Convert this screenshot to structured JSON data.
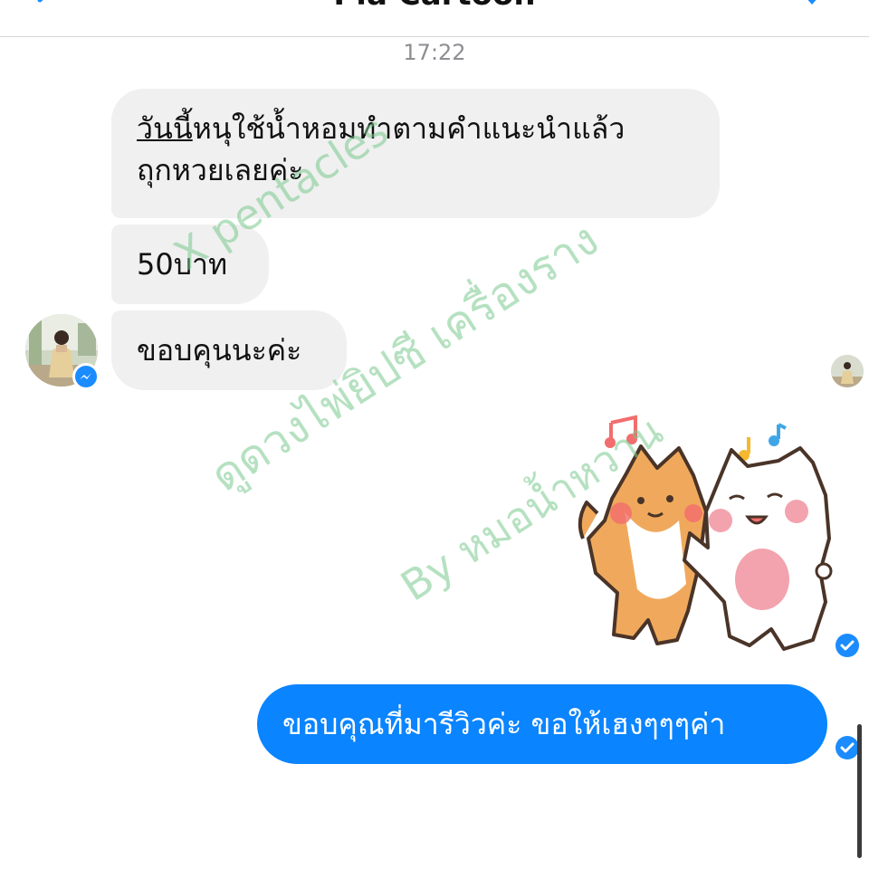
{
  "header": {
    "title": "Pla Cartoon"
  },
  "conversation": {
    "timestamp": "17:22",
    "incoming": {
      "message_1_underlined": "วันนี้",
      "message_1_rest_line1": "หนุใช้น้ำหอมทำตามคำแนะนำแล้ว",
      "message_1_line2": "ถุกหวยเลยค่ะ",
      "message_2": "50บาท",
      "message_3": "ขอบคุนนะค่ะ"
    },
    "outgoing": {
      "message": "ขอบคุณที่มารีวิวค่ะ ขอให้เฮงๆๆๆค่า"
    }
  },
  "watermark": {
    "line_1": "X pentacles",
    "line_2": "ดูดวงไพ่ยิปซี เครื่องราง",
    "line_3": "By หมอน้ำหวาน"
  },
  "colors": {
    "outgoing_bubble": "#0a84ff",
    "incoming_bubble": "#f0f0f0",
    "messenger_badge": "#1a8cff",
    "watermark": "#78c88c"
  },
  "icons": {
    "back": "chevron-left-icon",
    "more": "chevron-down-icon",
    "badge": "messenger-icon",
    "sticker": "shiba-and-bunny-dancing-sticker",
    "read_receipt": "check-circle-icon"
  }
}
